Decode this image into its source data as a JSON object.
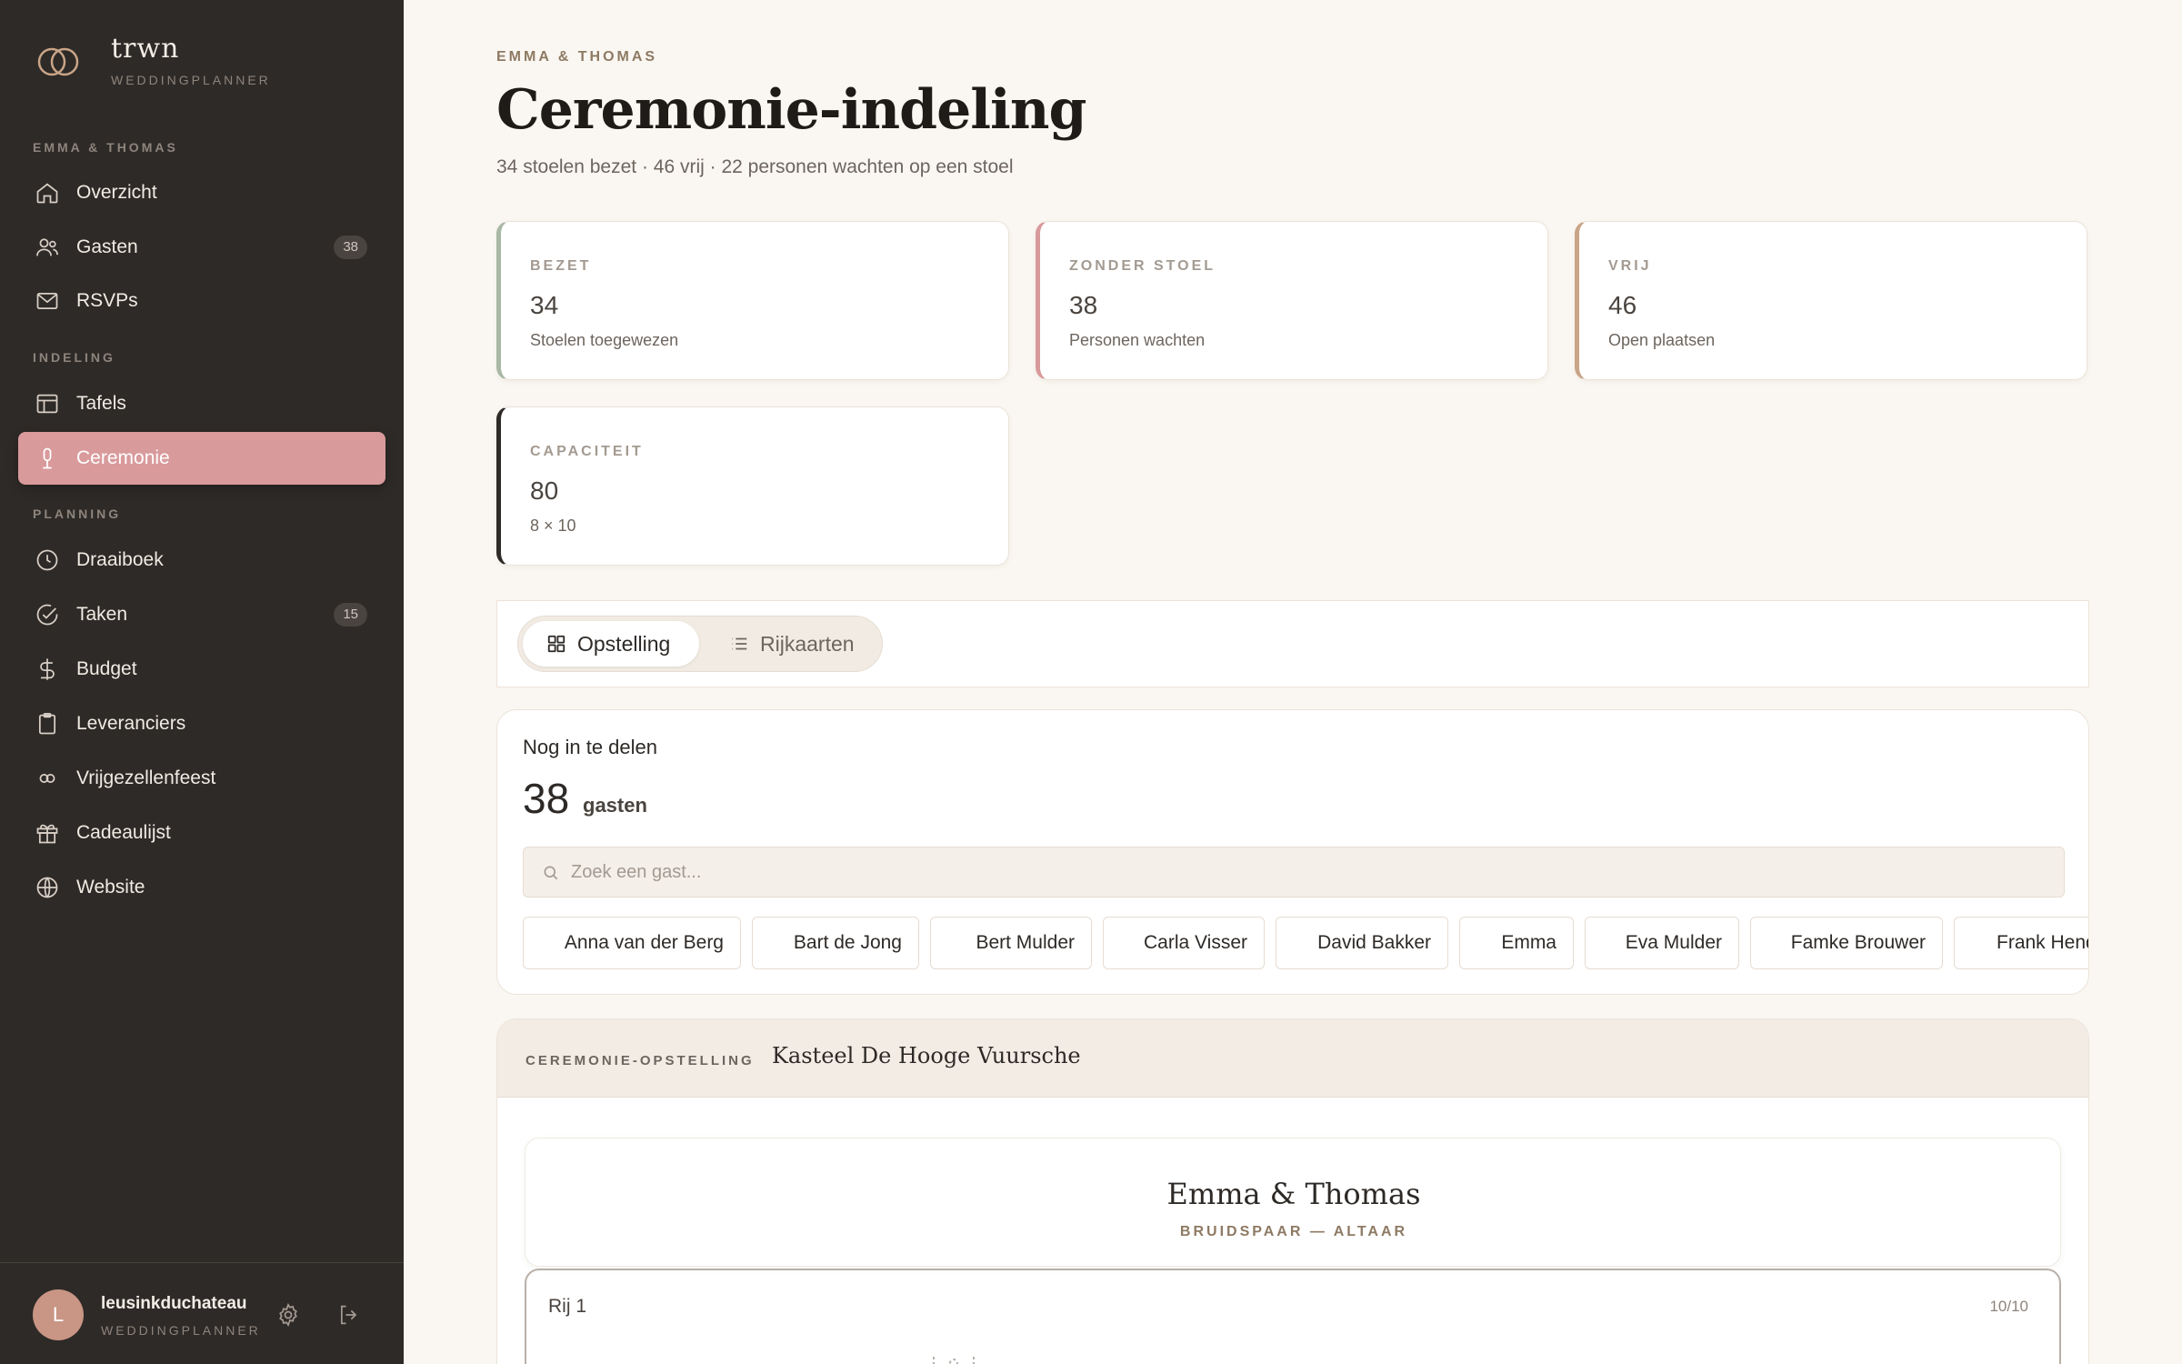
{
  "brand": {
    "name": "trwn",
    "subtitle": "WEDDINGPLANNER"
  },
  "sidebar": {
    "sections": [
      {
        "label": "EMMA & THOMAS"
      },
      {
        "label": "INDELING"
      },
      {
        "label": "PLANNING"
      }
    ],
    "items": [
      {
        "label": "Overzicht",
        "icon": "home-icon"
      },
      {
        "label": "Gasten",
        "icon": "users-icon",
        "badge": "38"
      },
      {
        "label": "RSVPs",
        "icon": "mail-icon"
      },
      {
        "label": "Tafels",
        "icon": "table-layout-icon"
      },
      {
        "label": "Ceremonie",
        "icon": "microphone-icon",
        "active": true
      },
      {
        "label": "Draaiboek",
        "icon": "clock-icon"
      },
      {
        "label": "Taken",
        "icon": "check-circle-icon",
        "badge": "15"
      },
      {
        "label": "Budget",
        "icon": "dollar-icon"
      },
      {
        "label": "Leveranciers",
        "icon": "clipboard-icon"
      },
      {
        "label": "Vrijgezellenfeest",
        "icon": "infinity-icon"
      },
      {
        "label": "Cadeaulijst",
        "icon": "gift-icon"
      },
      {
        "label": "Website",
        "icon": "globe-icon"
      }
    ],
    "user": {
      "initial": "L",
      "name": "leusinkduchateau",
      "role": "WEDDINGPLANNER"
    }
  },
  "header": {
    "eyebrow": "EMMA & THOMAS",
    "title": "Ceremonie-indeling",
    "subtitle": "34 stoelen bezet · 46 vrij · 22 personen wachten op een stoel"
  },
  "stats": [
    {
      "label": "BEZET",
      "value": "34",
      "sub": "Stoelen toegewezen",
      "accent": "#a9b8a4"
    },
    {
      "label": "ZONDER STOEL",
      "value": "38",
      "sub": "Personen wachten",
      "accent": "#d99a9c"
    },
    {
      "label": "VRIJ",
      "value": "46",
      "sub": "Open plaatsen",
      "accent": "#c9a487"
    },
    {
      "label": "CAPACITEIT",
      "value": "80",
      "sub": "8 × 10",
      "accent": "#2e2a27"
    }
  ],
  "view_toggle": {
    "active": "Opstelling",
    "inactive": "Rijkaarten"
  },
  "unassigned": {
    "title": "Nog in te delen",
    "count": "38",
    "count_label": "gasten",
    "search_placeholder": "Zoek een gast...",
    "guests": [
      "Anna van der Berg",
      "Bart de Jong",
      "Bert Mulder",
      "Carla Visser",
      "David Bakker",
      "Emma",
      "Eva Mulder",
      "Famke Brouwer",
      "Frank Hendriks"
    ]
  },
  "ceremony": {
    "label": "CEREMONIE-OPSTELLING",
    "venue": "Kasteel De Hooge Vuursche",
    "couple": "Emma & Thomas",
    "altar_label": "BRUIDSPAAR — ALTAAR",
    "rows": [
      {
        "label": "Rij 1",
        "count": "10/10"
      }
    ]
  },
  "colors": {
    "sidebar_bg": "#2e2a27",
    "accent_rose": "#d99a9c",
    "page_bg": "#faf7f2"
  }
}
